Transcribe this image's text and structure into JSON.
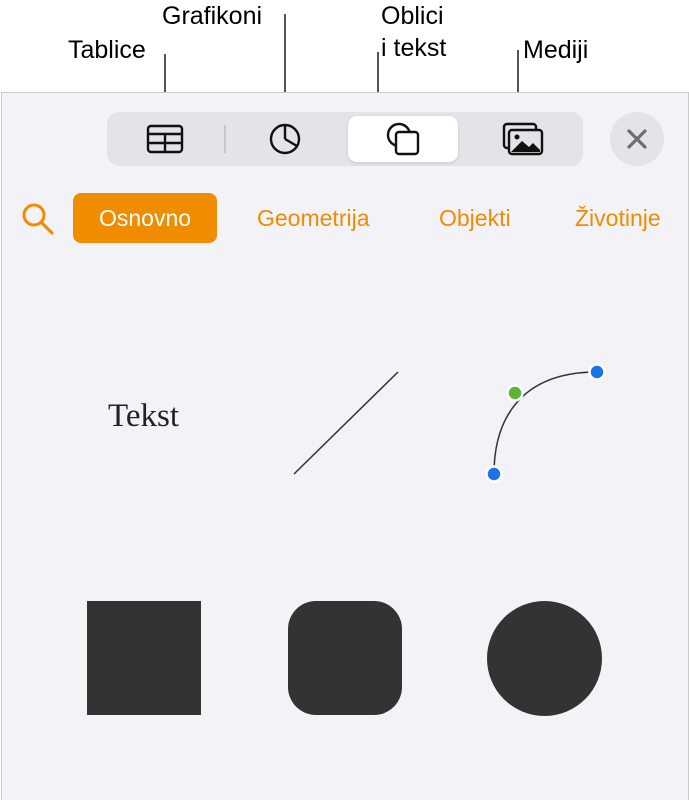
{
  "callouts": {
    "tables": "Tablice",
    "charts": "Grafikoni",
    "shapes_line1": "Oblici",
    "shapes_line2": "i tekst",
    "media": "Mediji"
  },
  "toolbar": {
    "tabs": [
      {
        "icon": "table-icon",
        "selected": false
      },
      {
        "icon": "chart-icon",
        "selected": false
      },
      {
        "icon": "shapes-icon",
        "selected": true
      },
      {
        "icon": "media-icon",
        "selected": false
      }
    ],
    "close_icon": "close-icon"
  },
  "categories": {
    "items": [
      "Osnovno",
      "Geometrija",
      "Objekti",
      "Životinje"
    ],
    "active": "Osnovno"
  },
  "shapes": {
    "text_box_label": "Tekst",
    "items": [
      "text-box",
      "line",
      "curve",
      "square",
      "rounded-square",
      "circle"
    ]
  },
  "colors": {
    "accent": "#f08c00",
    "shape_fill": "#333333",
    "panel_bg": "#f2f2f7",
    "point_blue": "#1a73e8",
    "point_green": "#5cb335"
  }
}
